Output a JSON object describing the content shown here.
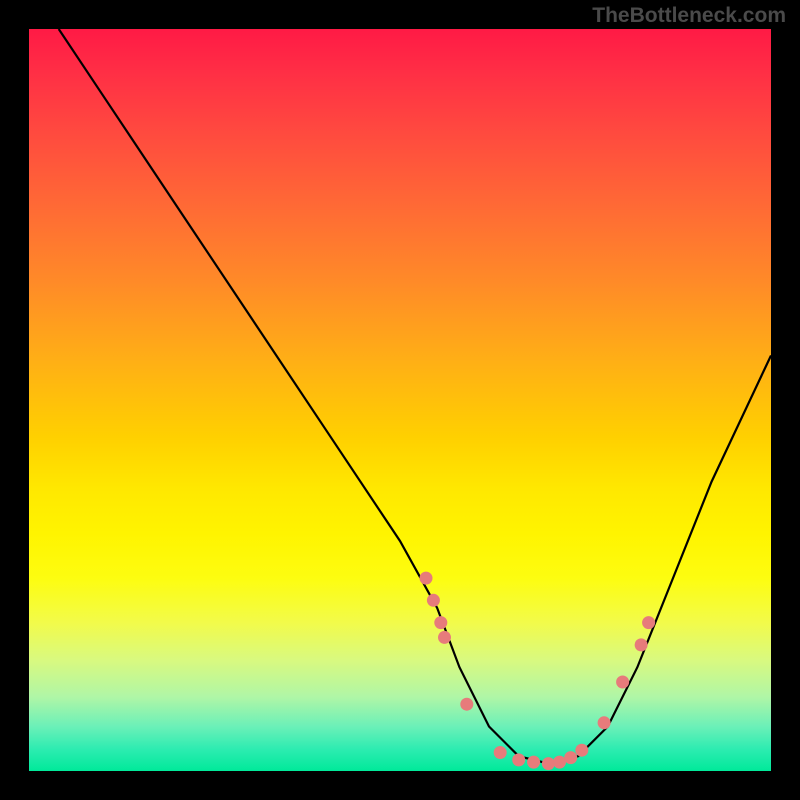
{
  "watermark": "TheBottleneck.com",
  "chart_data": {
    "type": "line",
    "title": "",
    "xlabel": "",
    "ylabel": "",
    "xlim": [
      0,
      100
    ],
    "ylim": [
      0,
      100
    ],
    "grid": false,
    "legend": false,
    "annotations": [
      "TheBottleneck.com"
    ],
    "series": [
      {
        "name": "curve",
        "color": "#000000",
        "x": [
          4,
          10,
          20,
          30,
          40,
          50,
          55,
          58,
          62,
          66,
          70,
          74,
          78,
          82,
          86,
          92,
          100
        ],
        "y": [
          100,
          91,
          76,
          61,
          46,
          31,
          22,
          14,
          6,
          2,
          1,
          2,
          6,
          14,
          24,
          39,
          56
        ]
      },
      {
        "name": "dots",
        "color": "#e77b7b",
        "type": "scatter",
        "x": [
          53.5,
          54.5,
          55.5,
          56.0,
          59.0,
          63.5,
          66.0,
          68.0,
          70.0,
          71.5,
          73.0,
          74.5,
          77.5,
          80.0,
          82.5,
          83.5
        ],
        "y": [
          26,
          23,
          20,
          18,
          9,
          2.5,
          1.5,
          1.2,
          1.0,
          1.2,
          1.8,
          2.8,
          6.5,
          12,
          17,
          20
        ]
      }
    ],
    "background_gradient": {
      "direction": "vertical",
      "stops": [
        {
          "pos": 0.0,
          "color": "#ff1a45"
        },
        {
          "pos": 0.5,
          "color": "#ffd000"
        },
        {
          "pos": 0.8,
          "color": "#f2fb4a"
        },
        {
          "pos": 1.0,
          "color": "#00e99a"
        }
      ]
    }
  }
}
